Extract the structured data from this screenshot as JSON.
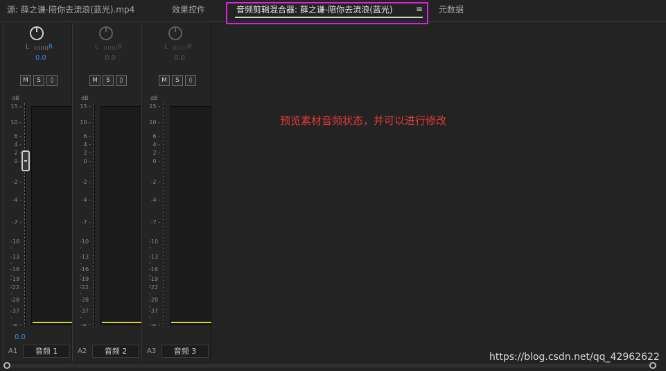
{
  "tabs": [
    {
      "label": "源: 薛之谦-陪你去流浪(蓝光).mp4"
    },
    {
      "label": "效果控件"
    },
    {
      "label": "音频剪辑混合器: 薛之谦-陪你去流浪(蓝光)"
    },
    {
      "label": "元数据"
    }
  ],
  "menu_icon": "≡",
  "mixer": {
    "scale_unit": "dB",
    "ticks": [
      "15",
      "10",
      "6",
      "4",
      "2",
      "0",
      "-2",
      "-4",
      "-7",
      "-10",
      "-13",
      "-16",
      "-19",
      "-22",
      "-28",
      "-37",
      "-∞"
    ],
    "buttons": {
      "mute": "M",
      "solo": "S",
      "record": "◊"
    },
    "channels": [
      {
        "id": "A1",
        "name": "音频 1",
        "pan_left": "L",
        "pan_right": "R",
        "pan_value": "0.0",
        "fader_value": "0.0",
        "active": true
      },
      {
        "id": "A2",
        "name": "音频 2",
        "pan_left": "L",
        "pan_right": "R",
        "pan_value": "0.0",
        "active": false
      },
      {
        "id": "A3",
        "name": "音频 3",
        "pan_left": "L",
        "pan_right": "R",
        "pan_value": "0.0",
        "active": false
      }
    ]
  },
  "annotation": "预览素材音频状态，并可以进行修改",
  "watermark": "https://blog.csdn.net/qq_42962622"
}
